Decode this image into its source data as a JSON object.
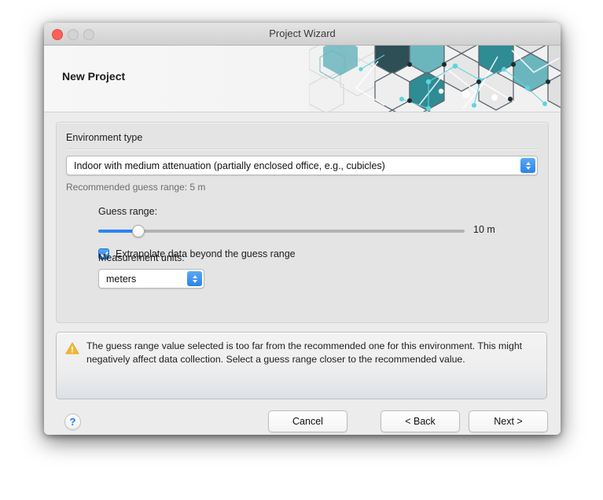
{
  "window": {
    "title": "Project Wizard",
    "traffic_lights": [
      "close-button",
      "minimize-button",
      "maximize-button"
    ]
  },
  "banner": {
    "heading": "New Project",
    "graphic": "hexagon-network-pattern",
    "colors": {
      "teal_dark": "#2d4f55",
      "teal_mid": "#2f8b94",
      "teal_light": "#6bb6bd",
      "cyan_accent": "#5fd3e0",
      "hex_stroke": "#5b6770",
      "hex_fill_light": "#e2e2e2"
    }
  },
  "form": {
    "environment_group_label": "Environment type",
    "environment_select": {
      "value": "Indoor with medium attenuation (partially enclosed office, e.g., cubicles)",
      "icon": "chevron-up-down-icon"
    },
    "recommended_text": "Recommended guess range: 5 m",
    "guess_range_label": "Guess range:",
    "guess_range_value_text": "10 m",
    "guess_range_percent": 11,
    "extrapolate_label": "Extrapolate data beyond the guess range",
    "extrapolate_checked": true,
    "measurement_units_label": "Measurement units:",
    "units_select": {
      "value": "meters",
      "icon": "chevron-up-down-icon"
    }
  },
  "warning": {
    "icon": "warning-triangle-icon",
    "accent_color": "#f5b731",
    "message": "The guess range value selected is too far from the recommended one for this environment. This might negatively affect data collection. Select a guess range closer to the recommended value."
  },
  "footer": {
    "help_label": "?",
    "cancel_label": "Cancel",
    "back_label": "< Back",
    "next_label": "Next >"
  }
}
